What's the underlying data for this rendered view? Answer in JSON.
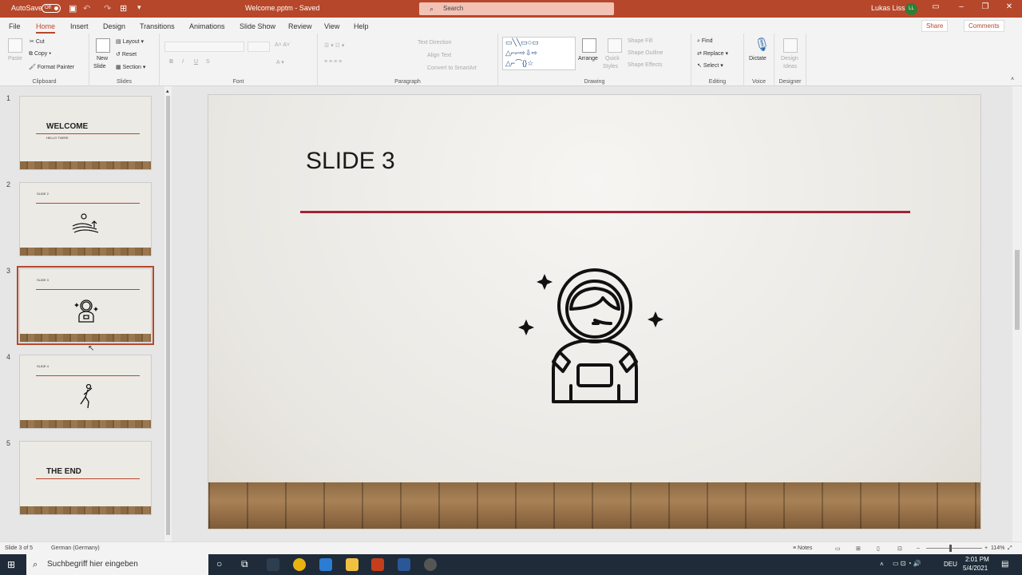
{
  "titlebar": {
    "autosave_label": "AutoSave",
    "autosave_state": "Off",
    "doc_title": "Welcome.pptm - Saved",
    "search_placeholder": "Search",
    "user_name": "Lukas Liss",
    "user_initials": "LL"
  },
  "menu": {
    "items": [
      "File",
      "Home",
      "Insert",
      "Design",
      "Transitions",
      "Animations",
      "Slide Show",
      "Review",
      "View",
      "Help"
    ],
    "active": "Home",
    "share_label": "Share",
    "comments_label": "Comments"
  },
  "ribbon": {
    "clipboard": {
      "label": "Clipboard",
      "paste": "Paste",
      "cut": "Cut",
      "copy": "Copy",
      "format_painter": "Format Painter"
    },
    "slides": {
      "label": "Slides",
      "new_slide": "New",
      "new_slide2": "Slide",
      "layout": "Layout",
      "reset": "Reset",
      "section": "Section"
    },
    "font": {
      "label": "Font",
      "bold": "B",
      "italic": "I",
      "underline": "U",
      "strike": "S"
    },
    "paragraph": {
      "label": "Paragraph",
      "text_direction": "Text Direction",
      "align_text": "Align Text",
      "convert_smartart": "Convert to SmartArt"
    },
    "drawing": {
      "label": "Drawing",
      "arrange": "Arrange",
      "quick_styles": "Quick",
      "quick_styles2": "Styles",
      "shape_fill": "Shape Fill",
      "shape_outline": "Shape Outline",
      "shape_effects": "Shape Effects"
    },
    "editing": {
      "label": "Editing",
      "find": "Find",
      "replace": "Replace",
      "select": "Select"
    },
    "voice": {
      "label": "Voice",
      "dictate": "Dictate"
    },
    "designer": {
      "label": "Designer",
      "design_ideas": "Design",
      "design_ideas2": "Ideas"
    }
  },
  "thumbnails": [
    {
      "num": "1",
      "title": "WELCOME",
      "subtitle": "HELLO THERE",
      "kind": "title"
    },
    {
      "num": "2",
      "title": "SLIDE 2",
      "kind": "content",
      "icon": "landscape-icon"
    },
    {
      "num": "3",
      "title": "SLIDE 3",
      "kind": "content",
      "icon": "astronaut-icon",
      "selected": true
    },
    {
      "num": "4",
      "title": "SLIDE 4",
      "kind": "content",
      "icon": "runner-icon"
    },
    {
      "num": "5",
      "title": "THE END",
      "kind": "title"
    }
  ],
  "slide": {
    "title": "SLIDE 3",
    "accent_color": "#a32136",
    "icon": "astronaut-icon"
  },
  "statusbar": {
    "slide_info": "Slide 3 of 5",
    "language": "German (Germany)",
    "notes": "Notes",
    "zoom": "114%"
  },
  "taskbar": {
    "search_placeholder": "Suchbegriff hier eingeben",
    "keyboard": "DEU",
    "time": "2:01 PM",
    "date": "5/4/2021"
  }
}
